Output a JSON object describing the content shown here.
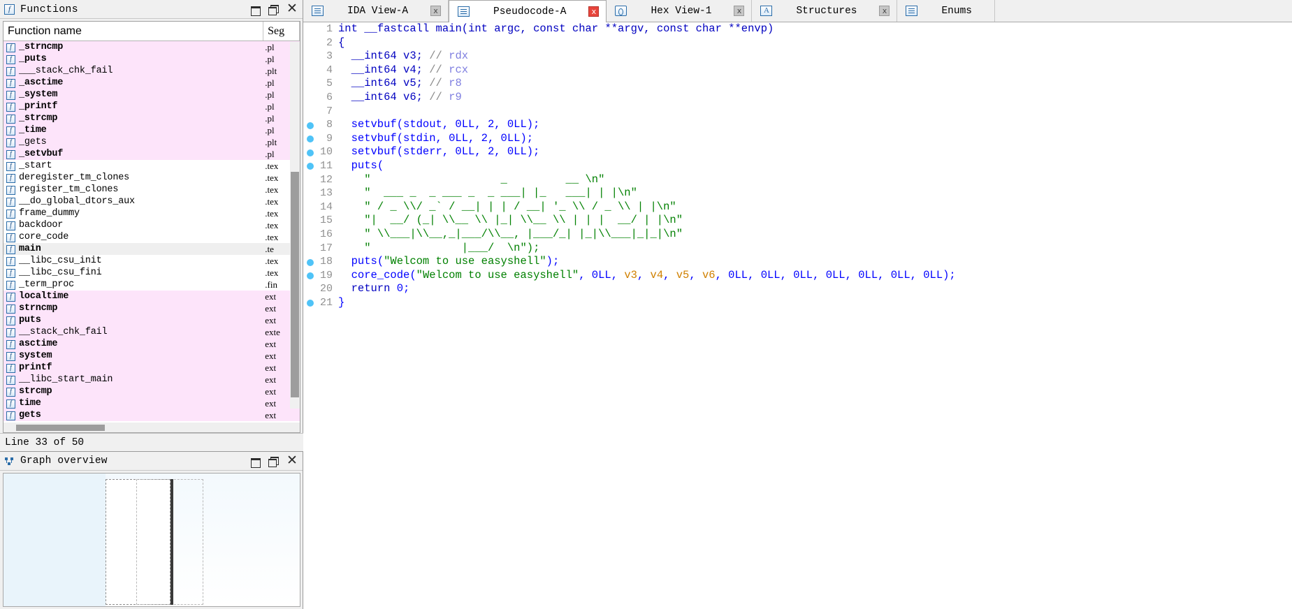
{
  "functions_window": {
    "title": "Functions",
    "icon": "function-icon",
    "buttons": {
      "restore": "restore-icon",
      "tile": "tile-icon",
      "close": "close-icon"
    },
    "columns": {
      "name": "Function name",
      "segment": "Seg"
    },
    "status": "Line 33 of 50",
    "rows": [
      {
        "name": "_strncmp",
        "seg": ".pl",
        "style": "plt",
        "bold": true
      },
      {
        "name": "_puts",
        "seg": ".pl",
        "style": "plt",
        "bold": true
      },
      {
        "name": "___stack_chk_fail",
        "seg": ".plt",
        "style": "plt",
        "bold": false
      },
      {
        "name": "_asctime",
        "seg": ".pl",
        "style": "plt",
        "bold": true
      },
      {
        "name": "_system",
        "seg": ".pl",
        "style": "plt",
        "bold": true
      },
      {
        "name": "_printf",
        "seg": ".pl",
        "style": "plt",
        "bold": true
      },
      {
        "name": "_strcmp",
        "seg": ".pl",
        "style": "plt",
        "bold": true
      },
      {
        "name": "_time",
        "seg": ".pl",
        "style": "plt",
        "bold": true
      },
      {
        "name": "_gets",
        "seg": ".plt",
        "style": "plt",
        "bold": false
      },
      {
        "name": "_setvbuf",
        "seg": ".pl",
        "style": "plt",
        "bold": true
      },
      {
        "name": "_start",
        "seg": ".tex",
        "style": "",
        "bold": false
      },
      {
        "name": "deregister_tm_clones",
        "seg": ".tex",
        "style": "",
        "bold": false
      },
      {
        "name": "register_tm_clones",
        "seg": ".tex",
        "style": "",
        "bold": false
      },
      {
        "name": "__do_global_dtors_aux",
        "seg": ".tex",
        "style": "",
        "bold": false
      },
      {
        "name": "frame_dummy",
        "seg": ".tex",
        "style": "",
        "bold": false
      },
      {
        "name": "backdoor",
        "seg": ".tex",
        "style": "",
        "bold": false
      },
      {
        "name": "core_code",
        "seg": ".tex",
        "style": "",
        "bold": false
      },
      {
        "name": "main",
        "seg": ".te",
        "style": "sel",
        "bold": true
      },
      {
        "name": "__libc_csu_init",
        "seg": ".tex",
        "style": "",
        "bold": false
      },
      {
        "name": "__libc_csu_fini",
        "seg": ".tex",
        "style": "",
        "bold": false
      },
      {
        "name": "_term_proc",
        "seg": ".fin",
        "style": "",
        "bold": false
      },
      {
        "name": "localtime",
        "seg": "ext",
        "style": "ext",
        "bold": true
      },
      {
        "name": "strncmp",
        "seg": "ext",
        "style": "ext",
        "bold": true
      },
      {
        "name": "puts",
        "seg": "ext",
        "style": "ext",
        "bold": true
      },
      {
        "name": "__stack_chk_fail",
        "seg": "exte",
        "style": "ext",
        "bold": false
      },
      {
        "name": "asctime",
        "seg": "ext",
        "style": "ext",
        "bold": true
      },
      {
        "name": "system",
        "seg": "ext",
        "style": "ext",
        "bold": true
      },
      {
        "name": "printf",
        "seg": "ext",
        "style": "ext",
        "bold": true
      },
      {
        "name": "__libc_start_main",
        "seg": "ext",
        "style": "ext",
        "bold": false
      },
      {
        "name": "strcmp",
        "seg": "ext",
        "style": "ext",
        "bold": true
      },
      {
        "name": "time",
        "seg": "ext",
        "style": "ext",
        "bold": true
      },
      {
        "name": "gets",
        "seg": "ext",
        "style": "ext",
        "bold": true
      }
    ]
  },
  "graph_window": {
    "title": "Graph overview",
    "icon": "graph-icon",
    "buttons": {
      "restore": "restore-icon",
      "tile": "tile-icon",
      "close": "close-icon"
    }
  },
  "tabs": [
    {
      "label": "IDA View-A",
      "icon": "document-icon",
      "active": false,
      "close": "x",
      "close_style": "grey"
    },
    {
      "label": "Pseudocode-A",
      "icon": "document-icon",
      "active": true,
      "close": "x",
      "close_style": "red"
    },
    {
      "label": "Hex View-1",
      "icon": "hexview-icon",
      "active": false,
      "close": "x",
      "close_style": "grey"
    },
    {
      "label": "Structures",
      "icon": "structure-icon",
      "active": false,
      "close": "x",
      "close_style": "grey"
    },
    {
      "label": "Enums",
      "icon": "enums-icon",
      "active": false,
      "close": "",
      "close_style": "none"
    }
  ],
  "pseudocode": {
    "lines": [
      {
        "n": "1",
        "bp": false,
        "segments": [
          {
            "t": "int ",
            "c": "k"
          },
          {
            "t": "__fastcall ",
            "c": "k"
          },
          {
            "t": "main",
            "c": "k"
          },
          {
            "t": "(",
            "c": "k"
          },
          {
            "t": "int ",
            "c": "k"
          },
          {
            "t": "argc",
            "c": "k"
          },
          {
            "t": ", ",
            "c": "k"
          },
          {
            "t": "const char ",
            "c": "k"
          },
          {
            "t": "**argv",
            "c": "k"
          },
          {
            "t": ", ",
            "c": "k"
          },
          {
            "t": "const char ",
            "c": "k"
          },
          {
            "t": "**envp",
            "c": "k"
          },
          {
            "t": ")",
            "c": "k"
          }
        ]
      },
      {
        "n": "2",
        "bp": false,
        "segments": [
          {
            "t": "{",
            "c": "k"
          }
        ]
      },
      {
        "n": "3",
        "bp": false,
        "segments": [
          {
            "t": "  __int64 ",
            "c": "k"
          },
          {
            "t": "v3",
            "c": "k"
          },
          {
            "t": "; ",
            "c": "k"
          },
          {
            "t": "// ",
            "c": "cmt"
          },
          {
            "t": "rdx",
            "c": "reg"
          }
        ]
      },
      {
        "n": "4",
        "bp": false,
        "segments": [
          {
            "t": "  __int64 ",
            "c": "k"
          },
          {
            "t": "v4",
            "c": "k"
          },
          {
            "t": "; ",
            "c": "k"
          },
          {
            "t": "// ",
            "c": "cmt"
          },
          {
            "t": "rcx",
            "c": "reg"
          }
        ]
      },
      {
        "n": "5",
        "bp": false,
        "segments": [
          {
            "t": "  __int64 ",
            "c": "k"
          },
          {
            "t": "v5",
            "c": "k"
          },
          {
            "t": "; ",
            "c": "k"
          },
          {
            "t": "// ",
            "c": "cmt"
          },
          {
            "t": "r8",
            "c": "reg"
          }
        ]
      },
      {
        "n": "6",
        "bp": false,
        "segments": [
          {
            "t": "  __int64 ",
            "c": "k"
          },
          {
            "t": "v6",
            "c": "k"
          },
          {
            "t": "; ",
            "c": "k"
          },
          {
            "t": "// ",
            "c": "cmt"
          },
          {
            "t": "r9",
            "c": "reg"
          }
        ]
      },
      {
        "n": "7",
        "bp": false,
        "segments": [
          {
            "t": "",
            "c": "k"
          }
        ]
      },
      {
        "n": "8",
        "bp": true,
        "segments": [
          {
            "t": "  setvbuf",
            "c": "kw"
          },
          {
            "t": "(stdout, 0LL, 2, 0LL);",
            "c": "kw"
          }
        ]
      },
      {
        "n": "9",
        "bp": true,
        "segments": [
          {
            "t": "  setvbuf",
            "c": "kw"
          },
          {
            "t": "(stdin, 0LL, 2, 0LL);",
            "c": "kw"
          }
        ]
      },
      {
        "n": "10",
        "bp": true,
        "segments": [
          {
            "t": "  setvbuf",
            "c": "kw"
          },
          {
            "t": "(stderr, 0LL, 2, 0LL);",
            "c": "kw"
          }
        ]
      },
      {
        "n": "11",
        "bp": true,
        "segments": [
          {
            "t": "  puts",
            "c": "kw"
          },
          {
            "t": "(",
            "c": "kw"
          }
        ]
      },
      {
        "n": "12",
        "bp": false,
        "segments": [
          {
            "t": "    \"",
            "c": "str"
          },
          {
            "t": "                    _         __ ",
            "c": "art"
          },
          {
            "t": "\\n\"",
            "c": "str"
          }
        ]
      },
      {
        "n": "13",
        "bp": false,
        "segments": [
          {
            "t": "    \"",
            "c": "str"
          },
          {
            "t": "  ___ _  _ ___ _  _ ___| |_   ___| | |",
            "c": "art"
          },
          {
            "t": "\\n\"",
            "c": "str"
          }
        ]
      },
      {
        "n": "14",
        "bp": false,
        "segments": [
          {
            "t": "    \"",
            "c": "str"
          },
          {
            "t": " / _ \\\\/ _` / __| | | / __| '_ \\\\ / _ \\\\ | |",
            "c": "art"
          },
          {
            "t": "\\n\"",
            "c": "str"
          }
        ]
      },
      {
        "n": "15",
        "bp": false,
        "segments": [
          {
            "t": "    \"",
            "c": "str"
          },
          {
            "t": "|  __/ (_| \\\\__ \\\\ |_| \\\\__ \\\\ | | |  __/ | |",
            "c": "art"
          },
          {
            "t": "\\n\"",
            "c": "str"
          }
        ]
      },
      {
        "n": "16",
        "bp": false,
        "segments": [
          {
            "t": "    \"",
            "c": "str"
          },
          {
            "t": " \\\\___|\\\\__,_|___/\\\\__, |___/_| |_|\\\\___|_|_|",
            "c": "art"
          },
          {
            "t": "\\n\"",
            "c": "str"
          }
        ]
      },
      {
        "n": "17",
        "bp": false,
        "segments": [
          {
            "t": "    \"",
            "c": "str"
          },
          {
            "t": "              |___/  ",
            "c": "art"
          },
          {
            "t": "\\n\");",
            "c": "str"
          }
        ]
      },
      {
        "n": "18",
        "bp": true,
        "segments": [
          {
            "t": "  puts",
            "c": "kw"
          },
          {
            "t": "(",
            "c": "kw"
          },
          {
            "t": "\"Welcom to use easyshell\"",
            "c": "str"
          },
          {
            "t": ");",
            "c": "kw"
          }
        ]
      },
      {
        "n": "19",
        "bp": true,
        "segments": [
          {
            "t": "  core_code",
            "c": "kw"
          },
          {
            "t": "(",
            "c": "kw"
          },
          {
            "t": "\"Welcom to use easyshell\"",
            "c": "str"
          },
          {
            "t": ", 0LL, ",
            "c": "kw"
          },
          {
            "t": "v3",
            "c": "var"
          },
          {
            "t": ", ",
            "c": "kw"
          },
          {
            "t": "v4",
            "c": "var"
          },
          {
            "t": ", ",
            "c": "kw"
          },
          {
            "t": "v5",
            "c": "var"
          },
          {
            "t": ", ",
            "c": "kw"
          },
          {
            "t": "v6",
            "c": "var"
          },
          {
            "t": ", 0LL, 0LL, 0LL, 0LL, 0LL, 0LL, 0LL);",
            "c": "kw"
          }
        ]
      },
      {
        "n": "20",
        "bp": false,
        "segments": [
          {
            "t": "  return ",
            "c": "k"
          },
          {
            "t": "0;",
            "c": "kw"
          }
        ]
      },
      {
        "n": "21",
        "bp": true,
        "segments": [
          {
            "t": "}",
            "c": "kw"
          }
        ]
      }
    ]
  },
  "colors": {
    "plt_row_bg": "#fde4fa",
    "selected_row_bg": "#efefef",
    "breakpoint": "#4fc3f7",
    "string_green": "#008000",
    "keyword_blue": "#0000ff",
    "comment_grey": "#8a8a8a",
    "register_purple": "#7e7ee0",
    "variable_orange": "#d08000",
    "tab_close_red": "#e8453c"
  }
}
